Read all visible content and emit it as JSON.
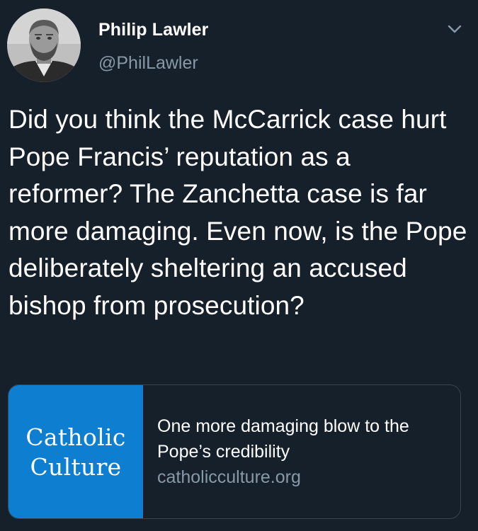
{
  "author": {
    "display_name": "Philip Lawler",
    "handle": "@PhilLawler",
    "avatar_icon": "profile-photo"
  },
  "menu": {
    "icon": "chevron-down-icon"
  },
  "tweet": {
    "text": "Did you think the McCarrick case hurt Pope Francis’ reputation as a reformer? The Zanchetta case is far more damaging. Even now, is the Pope deliberately sheltering an accused bishop from prosecution?"
  },
  "link_card": {
    "thumbnail_lines": [
      "Catholic",
      "Culture"
    ],
    "title": "One more damaging blow to the Pope’s credibility",
    "domain": "catholicculture.org",
    "thumbnail_color": "#0e7fd0"
  },
  "colors": {
    "background": "#15202b",
    "text_primary": "#ffffff",
    "text_secondary": "#8899a6",
    "border": "#38444d"
  }
}
